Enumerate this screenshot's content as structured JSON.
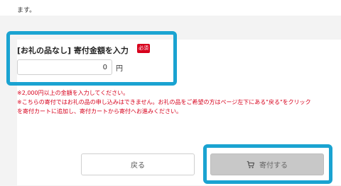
{
  "header": {
    "partial_text": "ます。"
  },
  "form": {
    "label": "[お礼の品なし] 寄付金額を入力",
    "required_badge": "必須",
    "amount_value": "0",
    "unit": "円"
  },
  "notes": [
    "※2,000円以上の金額を入力してください。",
    "※こちらの寄付ではお礼の品の申し込みはできません。お礼の品をご希望の方はページ左下にある\"戻る\"をクリック",
    "を寄付カートに追加し、寄付カートから寄付へお進みください。"
  ],
  "buttons": {
    "back_label": "戻る",
    "donate_label": "寄付する"
  },
  "colors": {
    "required": "#d7001c",
    "highlight": "#1aa3d1",
    "disabled_button": "#c8c8c8"
  },
  "icons": {
    "donate": "cart-icon"
  }
}
